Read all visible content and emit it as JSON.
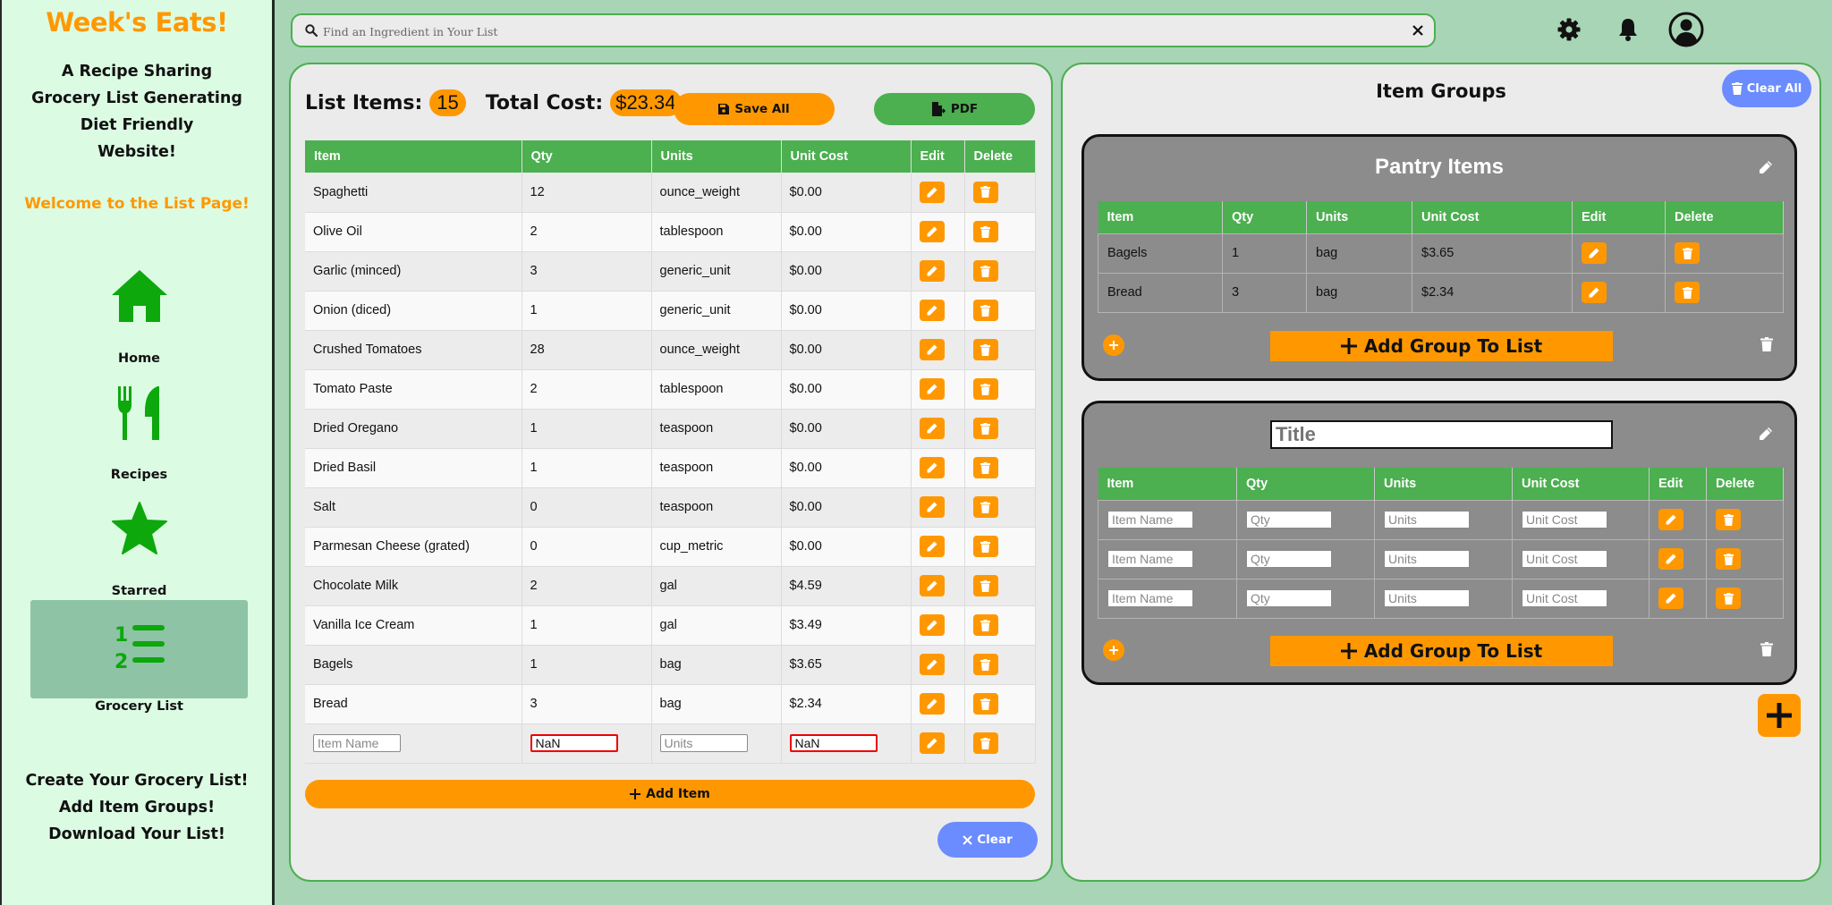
{
  "sidebar": {
    "brand": "Week's Eats!",
    "tagline": [
      "A Recipe Sharing",
      "Grocery List Generating",
      "Diet Friendly",
      "Website!"
    ],
    "welcome": "Welcome to the List Page!",
    "nav": [
      {
        "label": "Home",
        "icon": "home-icon"
      },
      {
        "label": "Recipes",
        "icon": "utensils-icon"
      },
      {
        "label": "Starred",
        "icon": "star-icon"
      },
      {
        "label": "Grocery List",
        "icon": "list-ol-icon",
        "active": true
      }
    ],
    "footer": [
      "Create Your Grocery List!",
      "Add Item Groups!",
      "Download Your List!"
    ]
  },
  "search": {
    "placeholder": "Find an Ingredient in Your List"
  },
  "list": {
    "items_label": "List Items:",
    "items_count": "15",
    "cost_label": "Total Cost:",
    "total_cost": "$23.34",
    "save_all": "Save All",
    "pdf": "PDF",
    "columns": [
      "Item",
      "Qty",
      "Units",
      "Unit Cost",
      "Edit",
      "Delete"
    ],
    "rows": [
      {
        "item": "Spaghetti",
        "qty": "12",
        "units": "ounce_weight",
        "cost": "$0.00"
      },
      {
        "item": "Olive Oil",
        "qty": "2",
        "units": "tablespoon",
        "cost": "$0.00"
      },
      {
        "item": "Garlic (minced)",
        "qty": "3",
        "units": "generic_unit",
        "cost": "$0.00"
      },
      {
        "item": "Onion (diced)",
        "qty": "1",
        "units": "generic_unit",
        "cost": "$0.00"
      },
      {
        "item": "Crushed Tomatoes",
        "qty": "28",
        "units": "ounce_weight",
        "cost": "$0.00"
      },
      {
        "item": "Tomato Paste",
        "qty": "2",
        "units": "tablespoon",
        "cost": "$0.00"
      },
      {
        "item": "Dried Oregano",
        "qty": "1",
        "units": "teaspoon",
        "cost": "$0.00"
      },
      {
        "item": "Dried Basil",
        "qty": "1",
        "units": "teaspoon",
        "cost": "$0.00"
      },
      {
        "item": "Salt",
        "qty": "0",
        "units": "teaspoon",
        "cost": "$0.00"
      },
      {
        "item": "Parmesan Cheese (grated)",
        "qty": "0",
        "units": "cup_metric",
        "cost": "$0.00"
      },
      {
        "item": "Chocolate Milk",
        "qty": "2",
        "units": "gal",
        "cost": "$4.59"
      },
      {
        "item": "Vanilla Ice Cream",
        "qty": "1",
        "units": "gal",
        "cost": "$3.49"
      },
      {
        "item": "Bagels",
        "qty": "1",
        "units": "bag",
        "cost": "$3.65"
      },
      {
        "item": "Bread",
        "qty": "3",
        "units": "bag",
        "cost": "$2.34"
      }
    ],
    "new_row": {
      "item_placeholder": "Item Name",
      "qty_value": "NaN",
      "units_placeholder": "Units",
      "cost_value": "NaN"
    },
    "add_item": "Add Item",
    "clear": "Clear"
  },
  "groups": {
    "title": "Item Groups",
    "clear_all": "Clear All",
    "columns": [
      "Item",
      "Qty",
      "Units",
      "Unit Cost",
      "Edit",
      "Delete"
    ],
    "add_group_label": "Add Group To List",
    "cards": [
      {
        "title": "Pantry Items",
        "rows": [
          {
            "item": "Bagels",
            "qty": "1",
            "units": "bag",
            "cost": "$3.65"
          },
          {
            "item": "Bread",
            "qty": "3",
            "units": "bag",
            "cost": "$2.34"
          }
        ]
      },
      {
        "title_placeholder": "Title",
        "placeholders": {
          "item": "Item Name",
          "qty": "Qty",
          "units": "Units",
          "cost": "Unit Cost"
        },
        "row_count": 3
      }
    ]
  },
  "colors": {
    "accent": "#ff9800",
    "green": "#4caf50",
    "blue": "#6b8cff",
    "background": "#a8d5b5",
    "sidebar": "#dcfbe3"
  }
}
